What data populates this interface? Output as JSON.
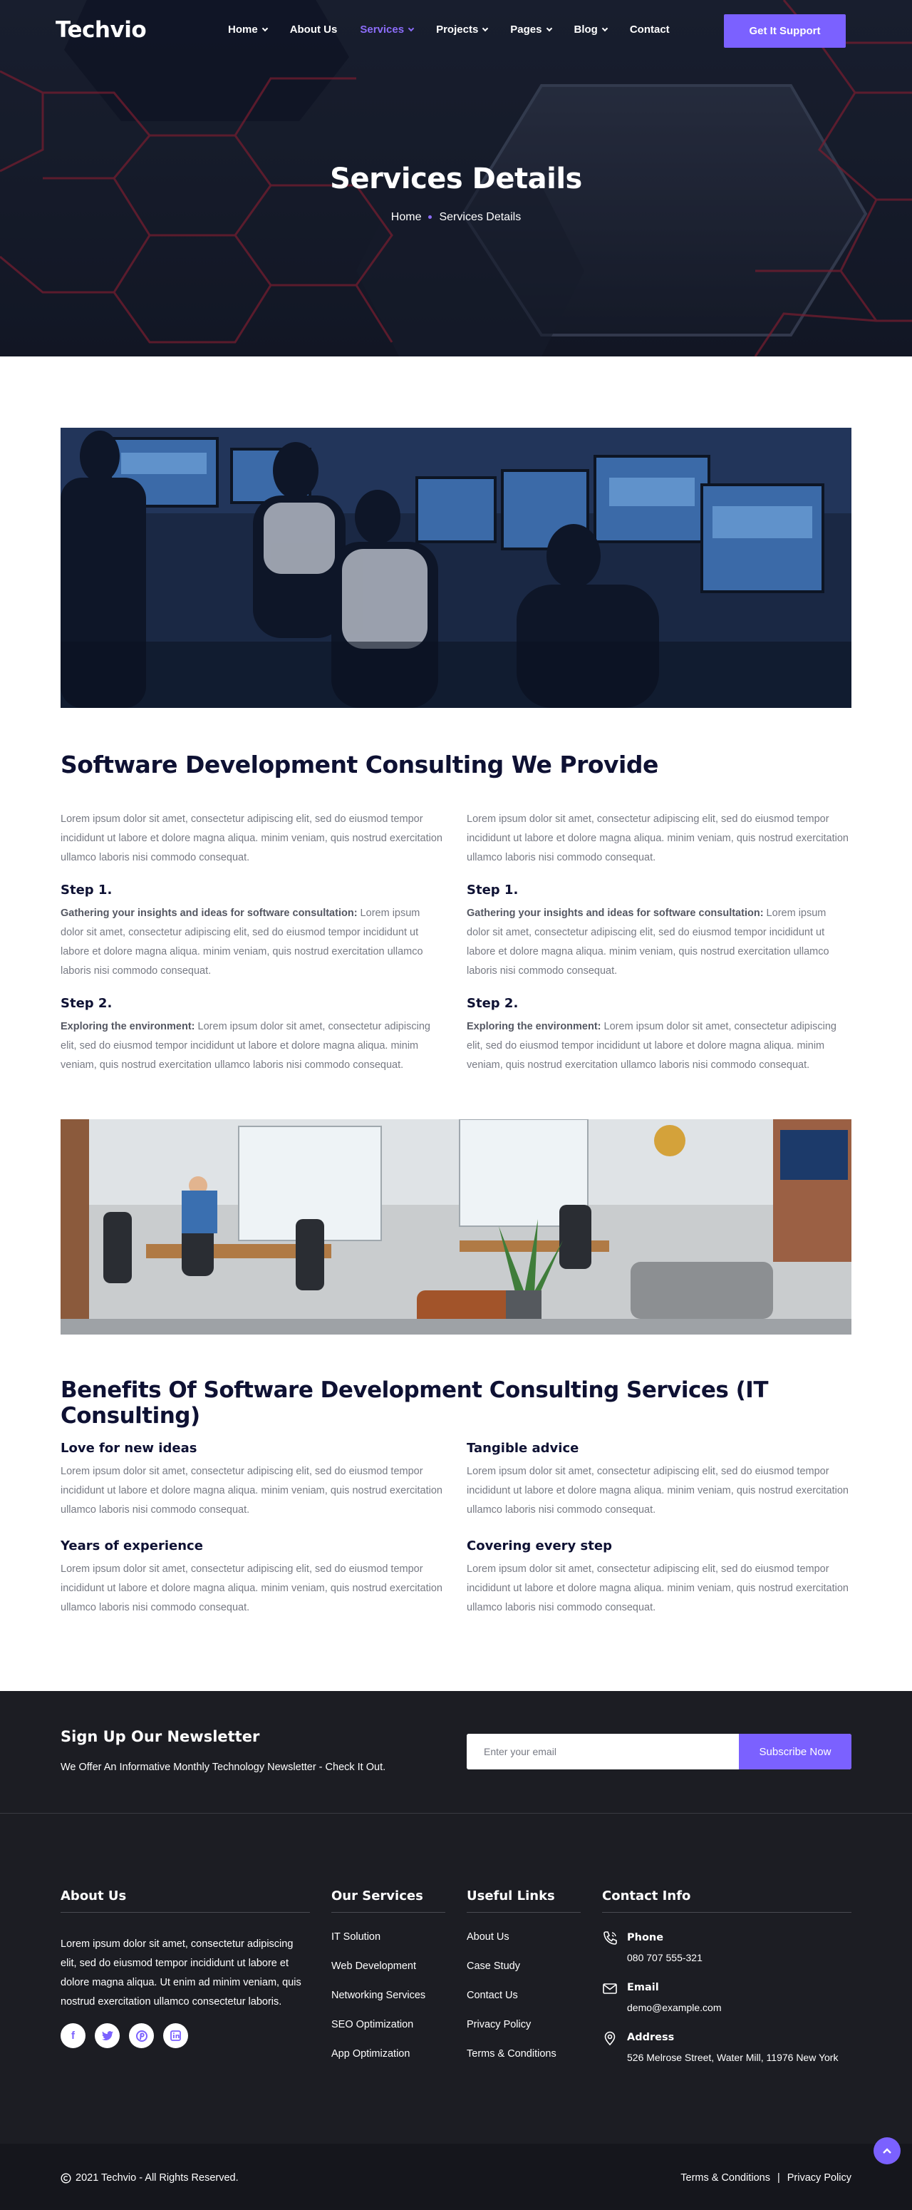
{
  "brand": {
    "logo": "Techvio",
    "accent": "#7b61ff"
  },
  "nav": {
    "items": [
      {
        "label": "Home",
        "dropdown": true
      },
      {
        "label": "About Us",
        "dropdown": false
      },
      {
        "label": "Services",
        "dropdown": true,
        "active": true
      },
      {
        "label": "Projects",
        "dropdown": true
      },
      {
        "label": "Pages",
        "dropdown": true
      },
      {
        "label": "Blog",
        "dropdown": true
      },
      {
        "label": "Contact",
        "dropdown": false
      }
    ],
    "cta": "Get It Support"
  },
  "hero": {
    "title": "Services Details",
    "breadcrumb": [
      "Home",
      "Services Details"
    ]
  },
  "section1": {
    "title": "Software Development Consulting We Provide",
    "columns": [
      {
        "intro": "Lorem ipsum dolor sit amet, consectetur adipiscing elit, sed do eiusmod tempor incididunt ut labore et dolore magna aliqua. minim veniam, quis nostrud exercitation ullamco laboris nisi commodo consequat.",
        "steps": [
          {
            "title": "Step 1.",
            "lead": "Gathering your insights and ideas for software consultation:",
            "text": " Lorem ipsum dolor sit amet, consectetur adipiscing elit, sed do eiusmod tempor incididunt ut labore et dolore magna aliqua. minim veniam, quis nostrud exercitation ullamco laboris nisi commodo consequat."
          },
          {
            "title": "Step 2.",
            "lead": "Exploring the environment:",
            "text": " Lorem ipsum dolor sit amet, consectetur adipiscing elit, sed do eiusmod tempor incididunt ut labore et dolore magna aliqua. minim veniam, quis nostrud exercitation ullamco laboris nisi commodo consequat."
          }
        ]
      },
      {
        "intro": "Lorem ipsum dolor sit amet, consectetur adipiscing elit, sed do eiusmod tempor incididunt ut labore et dolore magna aliqua. minim veniam, quis nostrud exercitation ullamco laboris nisi commodo consequat.",
        "steps": [
          {
            "title": "Step 1.",
            "lead": "Gathering your insights and ideas for software consultation:",
            "text": " Lorem ipsum dolor sit amet, consectetur adipiscing elit, sed do eiusmod tempor incididunt ut labore et dolore magna aliqua. minim veniam, quis nostrud exercitation ullamco laboris nisi commodo consequat."
          },
          {
            "title": "Step 2.",
            "lead": "Exploring the environment:",
            "text": " Lorem ipsum dolor sit amet, consectetur adipiscing elit, sed do eiusmod tempor incididunt ut labore et dolore magna aliqua. minim veniam, quis nostrud exercitation ullamco laboris nisi commodo consequat."
          }
        ]
      }
    ]
  },
  "section2": {
    "title": "Benefits Of Software Development Consulting Services (IT Consulting)",
    "benefits": [
      {
        "title": "Love for new ideas",
        "text": "Lorem ipsum dolor sit amet, consectetur adipiscing elit, sed do eiusmod tempor incididunt ut labore et dolore magna aliqua. minim veniam, quis nostrud exercitation ullamco laboris nisi commodo consequat."
      },
      {
        "title": "Tangible advice",
        "text": "Lorem ipsum dolor sit amet, consectetur adipiscing elit, sed do eiusmod tempor incididunt ut labore et dolore magna aliqua. minim veniam, quis nostrud exercitation ullamco laboris nisi commodo consequat."
      },
      {
        "title": "Years of experience",
        "text": "Lorem ipsum dolor sit amet, consectetur adipiscing elit, sed do eiusmod tempor incididunt ut labore et dolore magna aliqua. minim veniam, quis nostrud exercitation ullamco laboris nisi commodo consequat."
      },
      {
        "title": "Covering every step",
        "text": "Lorem ipsum dolor sit amet, consectetur adipiscing elit, sed do eiusmod tempor incididunt ut labore et dolore magna aliqua. minim veniam, quis nostrud exercitation ullamco laboris nisi commodo consequat."
      }
    ]
  },
  "newsletter": {
    "title": "Sign Up Our Newsletter",
    "subtitle": "We Offer An Informative Monthly Technology Newsletter - Check It Out.",
    "placeholder": "Enter your email",
    "button": "Subscribe Now"
  },
  "footer": {
    "about": {
      "heading": "About Us",
      "text": "Lorem ipsum dolor sit amet, consectetur adipiscing elit, sed do eiusmod tempor incididunt ut labore et dolore magna aliqua. Ut enim ad minim veniam, quis nostrud exercitation ullamco consectetur laboris.",
      "socials": [
        "facebook-icon",
        "twitter-icon",
        "pinterest-icon",
        "linkedin-icon"
      ]
    },
    "services": {
      "heading": "Our Services",
      "items": [
        "IT Solution",
        "Web Development",
        "Networking Services",
        "SEO Optimization",
        "App Optimization"
      ]
    },
    "links": {
      "heading": "Useful Links",
      "items": [
        "About Us",
        "Case Study",
        "Contact Us",
        "Privacy Policy",
        "Terms & Conditions"
      ]
    },
    "contact": {
      "heading": "Contact Info",
      "items": [
        {
          "icon": "phone-icon",
          "label": "Phone",
          "value": "080 707 555-321"
        },
        {
          "icon": "email-icon",
          "label": "Email",
          "value": "demo@example.com"
        },
        {
          "icon": "location-icon",
          "label": "Address",
          "value": "526 Melrose Street, Water Mill, 11976 New York"
        }
      ]
    },
    "copyright": "2021 Techvio - All Rights Reserved.",
    "legal": [
      "Terms & Conditions",
      "Privacy Policy"
    ]
  }
}
